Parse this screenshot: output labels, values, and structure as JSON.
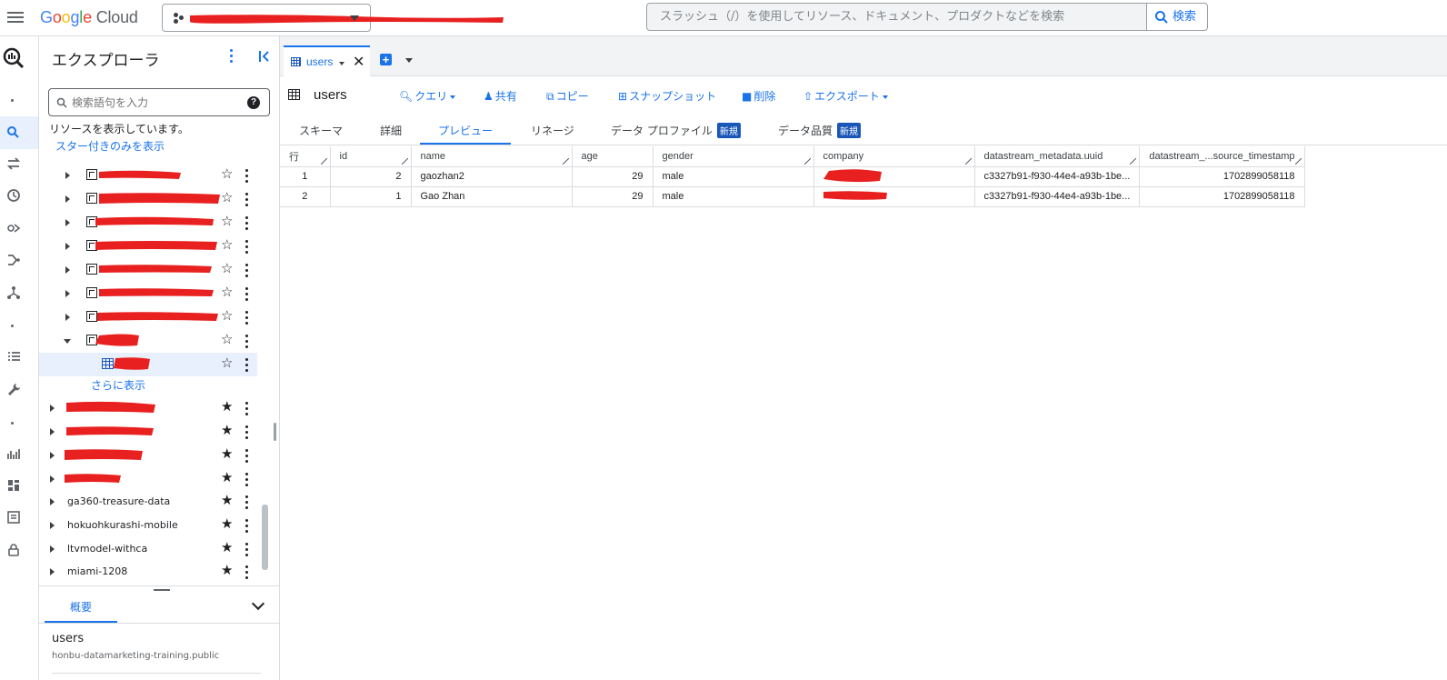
{
  "app": {
    "logo_text": "Google Cloud",
    "search_placeholder": "スラッシュ（/）を使用してリソース、ドキュメント、プロダクトなどを検索",
    "search_button": "検索"
  },
  "explorer": {
    "title": "エクスプローラ",
    "search_placeholder": "検索語句を入力",
    "info_text": "リソースを表示しています。",
    "starred_link": "スター付きのみを表示",
    "show_more": "さらに表示",
    "projects": [
      {
        "label": "ga360-treasure-data",
        "starred": true
      },
      {
        "label": "hokuohkurashi-mobile",
        "starred": true
      },
      {
        "label": "ltvmodel-withca",
        "starred": true
      },
      {
        "label": "miami-1208",
        "starred": true
      }
    ]
  },
  "details_panel": {
    "tab_label": "概要",
    "table_name": "users",
    "table_path": "honbu-datamarketing-training.public"
  },
  "main": {
    "tab": {
      "label": "users"
    },
    "toolbar": {
      "table_name": "users",
      "query": "クエリ",
      "share": "共有",
      "copy": "コピー",
      "snapshot": "スナップショット",
      "delete": "削除",
      "export": "エクスポート"
    },
    "subtabs": {
      "schema": "スキーマ",
      "details": "詳細",
      "preview": "プレビュー",
      "lineage": "リネージ",
      "data_profile": "データ プロファイル",
      "data_quality": "データ品質",
      "new_badge": "新規"
    },
    "grid": {
      "headers": [
        "行",
        "id",
        "name",
        "age",
        "gender",
        "company",
        "datastream_metadata.uuid",
        "datastream_...source_timestamp"
      ],
      "rows": [
        {
          "row": "1",
          "id": "2",
          "name": "gaozhan2",
          "age": "29",
          "gender": "male",
          "company": "",
          "uuid": "c3327b91-f930-44e4-a93b-1be...",
          "ts": "1702899058118"
        },
        {
          "row": "2",
          "id": "1",
          "name": "Gao Zhan",
          "age": "29",
          "gender": "male",
          "company": "",
          "uuid": "c3327b91-f930-44e4-a93b-1be...",
          "ts": "1702899058118"
        }
      ]
    }
  },
  "colors": {
    "accent": "#1a73e8",
    "redaction": "#e8201f",
    "badge": "#1a57b8"
  }
}
